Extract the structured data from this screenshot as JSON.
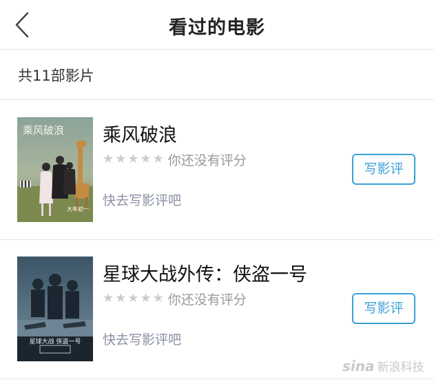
{
  "header": {
    "title": "看过的电影"
  },
  "summary": {
    "count_text": "共11部影片"
  },
  "movies": [
    {
      "title": "乘风破浪",
      "rating_text": "你还没有评分",
      "stars_filled": 0,
      "review_link": "快去写影评吧",
      "review_button": "写影评",
      "poster_text": "乘风破浪",
      "poster_tag": "大年初一"
    },
    {
      "title": "星球大战外传：侠盗一号",
      "rating_text": "你还没有评分",
      "stars_filled": 0,
      "review_link": "快去写影评吧",
      "review_button": "写影评",
      "poster_text": "星球大战 侠盗一号"
    }
  ],
  "watermark": {
    "logo": "sina",
    "text": "新浪科技"
  },
  "colors": {
    "accent": "#3aa0d8",
    "star_empty": "#cccccc",
    "divider": "#e6e6e6"
  }
}
